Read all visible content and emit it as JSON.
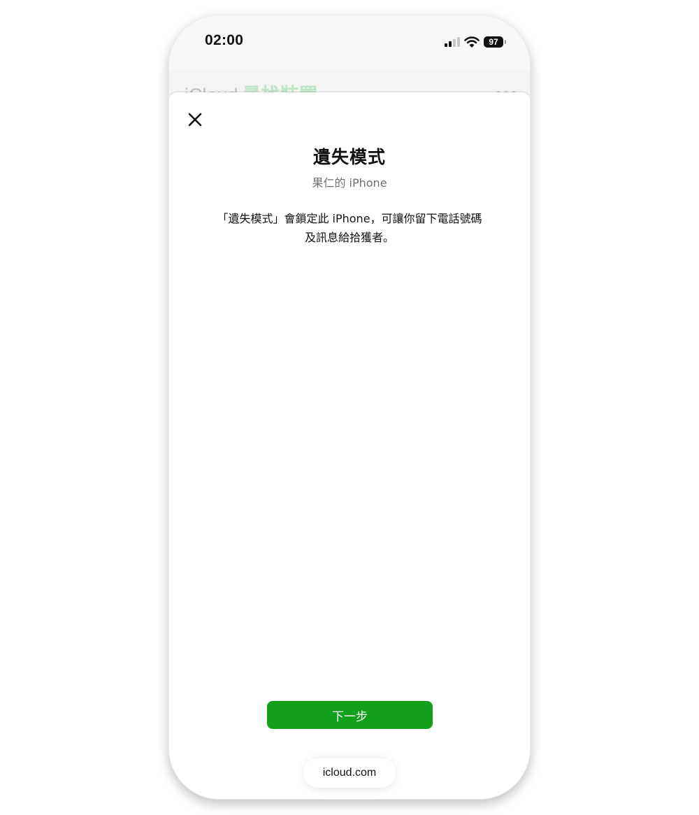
{
  "status_bar": {
    "time": "02:00",
    "battery": "97",
    "icons": [
      "cellular-signal-icon",
      "wifi-icon",
      "battery-icon"
    ]
  },
  "background_page": {
    "brand": "iCloud",
    "section": "尋找裝置",
    "brand_color": "#bdbdbd",
    "section_color": "#bfe3c4"
  },
  "sheet": {
    "title": "遺失模式",
    "subtitle": "果仁的 iPhone",
    "description_line1": "「遺失模式」會鎖定此 iPhone，可讓你留下電話號碼",
    "description_line2": "及訊息給拾獲者。",
    "next_button": "下一步",
    "button_color": "#12a01a"
  },
  "address_bar": {
    "url": "icloud.com"
  }
}
